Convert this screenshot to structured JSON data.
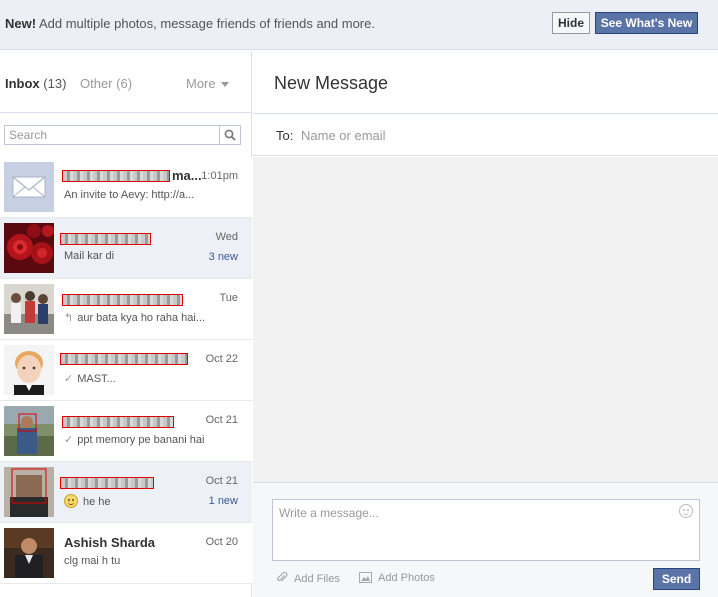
{
  "banner": {
    "new_label": "New!",
    "text": "Add multiple photos, message friends of friends and more.",
    "hide_label": "Hide",
    "whats_new_label": "See What's New"
  },
  "folders": {
    "inbox_label": "Inbox",
    "inbox_count": "(13)",
    "other_label": "Other",
    "other_count": "(6)",
    "more_label": "More"
  },
  "search": {
    "placeholder": "Search"
  },
  "threads": [
    {
      "name_suffix": "ma...",
      "time": "1:01pm",
      "snippet": "An invite to Aevy: http://a...",
      "new": "",
      "avatar": "envelope-placeholder"
    },
    {
      "name_suffix": "",
      "time": "Wed",
      "snippet": "Mail kar di",
      "new": "3 new",
      "avatar": "roses-photo"
    },
    {
      "name_suffix": "",
      "time": "Tue",
      "snippet": "aur bata kya ho raha hai...",
      "new": "",
      "avatar": "group-photo",
      "status_icon": "reply-icon"
    },
    {
      "name_suffix": "",
      "time": "Oct 22",
      "snippet": "MAST...",
      "new": "",
      "avatar": "child-photo",
      "status_icon": "check-icon"
    },
    {
      "name_suffix": "",
      "time": "Oct 21",
      "snippet": "ppt memory pe banani hai",
      "new": "",
      "avatar": "person-outdoor-photo",
      "status_icon": "check-icon"
    },
    {
      "name_suffix": "",
      "time": "Oct 21",
      "snippet": "he he",
      "new": "1 new",
      "avatar": "person-photo",
      "status_icon": "smiley-icon"
    },
    {
      "name": "Ashish Sharda",
      "time": "Oct 20",
      "snippet": "clg mai h tu",
      "new": "",
      "avatar": "person-dark-photo"
    }
  ],
  "composer": {
    "title": "New Message",
    "to_label": "To:",
    "to_placeholder": "Name or email",
    "message_placeholder": "Write a message...",
    "add_files_label": "Add Files",
    "add_photos_label": "Add Photos",
    "send_label": "Send"
  },
  "colors": {
    "accent": "#5b74a8",
    "link": "#3b5998",
    "banner_bg": "#eceff5",
    "unread_bg": "#edf0f6"
  }
}
